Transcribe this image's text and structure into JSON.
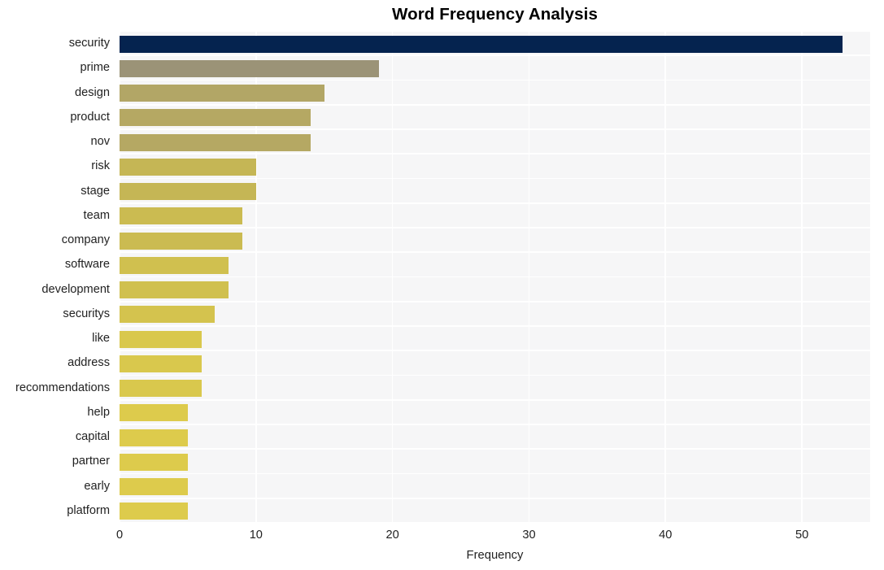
{
  "chart_data": {
    "type": "bar",
    "orientation": "horizontal",
    "title": "Word Frequency Analysis",
    "xlabel": "Frequency",
    "ylabel": "",
    "categories": [
      "security",
      "prime",
      "design",
      "product",
      "nov",
      "risk",
      "stage",
      "team",
      "company",
      "software",
      "development",
      "securitys",
      "like",
      "address",
      "recommendations",
      "help",
      "capital",
      "partner",
      "early",
      "platform"
    ],
    "values": [
      53,
      19,
      15,
      14,
      14,
      10,
      10,
      9,
      9,
      8,
      8,
      7,
      6,
      6,
      6,
      5,
      5,
      5,
      5,
      5
    ],
    "bar_colors": [
      "#05234f",
      "#9b9377",
      "#b2a666",
      "#b5a863",
      "#b5a863",
      "#c5b655",
      "#c5b655",
      "#cbbb51",
      "#cbbb51",
      "#d0c04f",
      "#d0c04f",
      "#d4c34e",
      "#d9c84d",
      "#d9c84d",
      "#d9c84d",
      "#ddcb4c",
      "#ddcb4c",
      "#ddcb4c",
      "#ddcb4c",
      "#ddcb4c"
    ],
    "xticks": [
      0,
      10,
      20,
      30,
      40,
      50
    ],
    "xticklabels": [
      "0",
      "10",
      "20",
      "30",
      "40",
      "50"
    ],
    "xlim": [
      0,
      55
    ],
    "grid": true,
    "grid_color": "#ffffff",
    "plot_background": "#f6f6f7",
    "figure_background": "#ffffff",
    "legend": null
  }
}
